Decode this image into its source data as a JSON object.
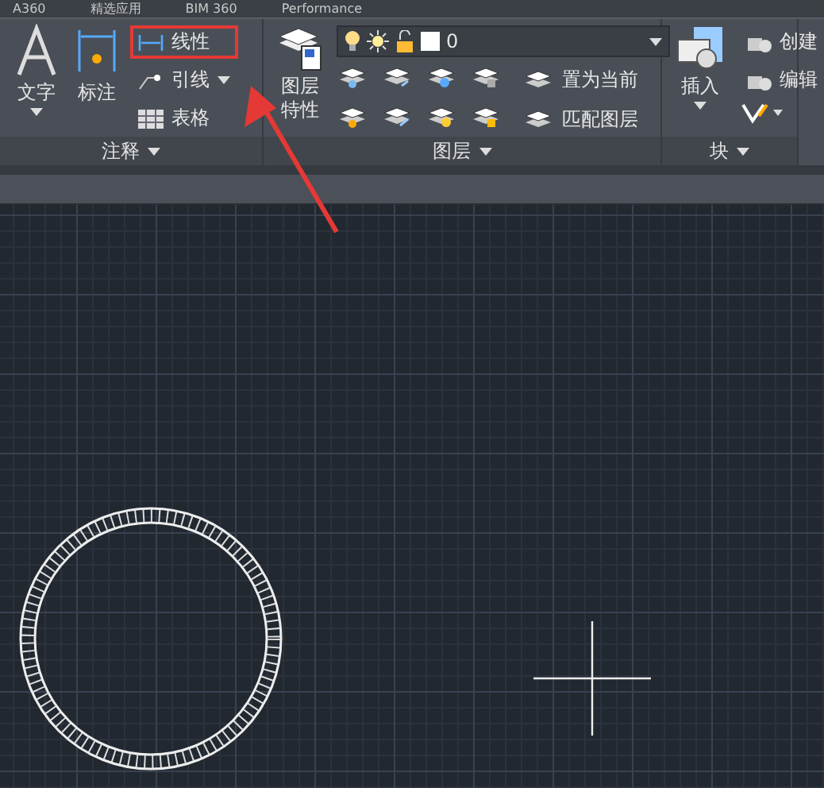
{
  "app_tabs": [
    "A360",
    "精选应用",
    "BIM 360",
    "Performance"
  ],
  "annotation_panel": {
    "title": "注释",
    "large_buttons": [
      {
        "label": "文字",
        "dropdown": true
      },
      {
        "label": "标注",
        "dropdown": false
      }
    ],
    "small_buttons": [
      {
        "label": "线性",
        "highlighted": true,
        "dropdown": false
      },
      {
        "label": "引线",
        "highlighted": false,
        "dropdown": true
      },
      {
        "label": "表格",
        "highlighted": false,
        "dropdown": false
      }
    ]
  },
  "layers_panel": {
    "title": "图层",
    "large_button": "图层特性",
    "layer_dropdown": {
      "value": "0"
    },
    "rows": [
      {
        "label": "置为当前"
      },
      {
        "label": "匹配图层"
      }
    ]
  },
  "block_panel": {
    "title": "块",
    "large_button": "插入",
    "small_buttons": [
      {
        "label": "创建"
      },
      {
        "label": "编辑"
      }
    ]
  }
}
